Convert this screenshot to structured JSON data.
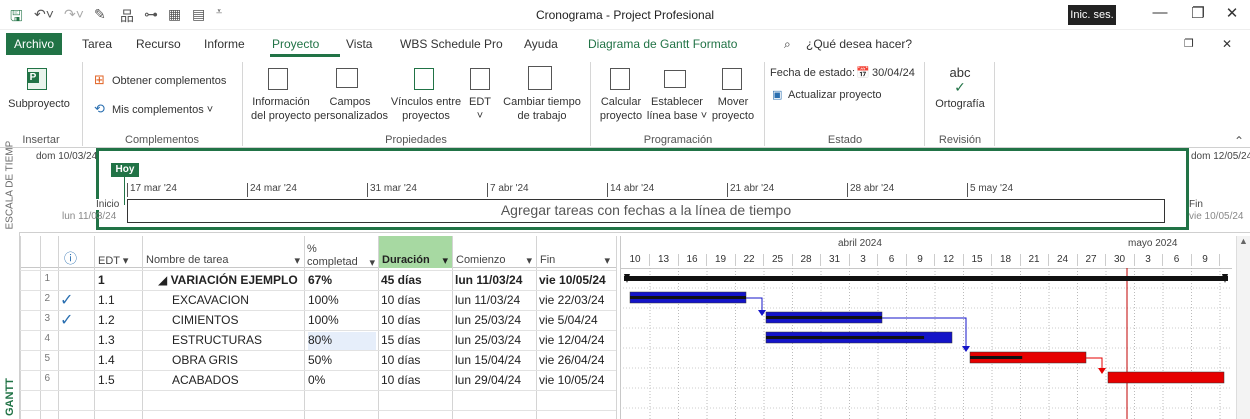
{
  "window": {
    "title": "Cronograma - Project Profesional",
    "signin": "Inic. ses.",
    "minimize": "—",
    "restore": "❐",
    "close": "✕",
    "ribbon_restore": "❐",
    "ribbon_close": "✕"
  },
  "menu": {
    "file": "Archivo",
    "tabs": [
      "Tarea",
      "Recurso",
      "Informe",
      "Proyecto",
      "Vista",
      "WBS Schedule Pro",
      "Ayuda"
    ],
    "context": "Diagrama de Gantt  Formato",
    "search": "¿Qué desea hacer?"
  },
  "ribbon": {
    "subproyecto": "Subproyecto",
    "obtener": "Obtener complementos",
    "mis": "Mis complementos",
    "info": [
      "Información",
      "del proyecto"
    ],
    "campos": [
      "Campos",
      "personalizados"
    ],
    "vinculos": [
      "Vínculos entre",
      "proyectos"
    ],
    "edt": "EDT",
    "cambiar": [
      "Cambiar tiempo",
      "de trabajo"
    ],
    "calcular": [
      "Calcular",
      "proyecto"
    ],
    "establecer": [
      "Establecer",
      "línea base"
    ],
    "mover": [
      "Mover",
      "proyecto"
    ],
    "fecha_estado_label": "Fecha de estado:",
    "fecha_estado_value": "30/04/24",
    "actualizar": "Actualizar proyecto",
    "abc": "abc",
    "ortografia": "Ortografía",
    "groups": [
      "Insertar",
      "Complementos",
      "Propiedades",
      "Programación",
      "Estado",
      "Revisión"
    ]
  },
  "timeline": {
    "side_label": "ESCALA DE TIEMPO",
    "left_date": "dom 10/03/24",
    "right_date": "dom 12/05/24",
    "today": "Hoy",
    "start_label": "Inicio",
    "start_date": "lun 11/03/24",
    "end_label": "Fin",
    "end_date": "vie 10/05/24",
    "placeholder": "Agregar tareas con fechas a la línea de tiempo",
    "ticks": [
      "17 mar '24",
      "24 mar '24",
      "31 mar '24",
      "7 abr '24",
      "14 abr '24",
      "21 abr '24",
      "28 abr '24",
      "5 may '24"
    ]
  },
  "table": {
    "side_label": "GANTT",
    "headers": {
      "info": "ⓘ",
      "edt": "EDT",
      "name": "Nombre de tarea",
      "pct1": "%",
      "pct2": "completad",
      "dur": "Duración",
      "start": "Comienzo",
      "end": "Fin"
    },
    "rows": [
      {
        "id": "1",
        "check": "",
        "edt": "1",
        "name": "◢ VARIACIÓN EJEMPLO",
        "pct": "67%",
        "dur": "45 días",
        "start": "lun 11/03/24",
        "end": "vie 10/05/24",
        "bold": true
      },
      {
        "id": "2",
        "check": "✓",
        "edt": "1.1",
        "name": "EXCAVACION",
        "pct": "100%",
        "dur": "10 días",
        "start": "lun 11/03/24",
        "end": "vie 22/03/24"
      },
      {
        "id": "3",
        "check": "✓",
        "edt": "1.2",
        "name": "CIMIENTOS",
        "pct": "100%",
        "dur": "10 días",
        "start": "lun 25/03/24",
        "end": "vie 5/04/24"
      },
      {
        "id": "4",
        "check": "",
        "edt": "1.3",
        "name": "ESTRUCTURAS",
        "pct": "80%",
        "dur": "15 días",
        "start": "lun 25/03/24",
        "end": "vie 12/04/24"
      },
      {
        "id": "5",
        "check": "",
        "edt": "1.4",
        "name": "OBRA GRIS",
        "pct": "50%",
        "dur": "10 días",
        "start": "lun 15/04/24",
        "end": "vie 26/04/24"
      },
      {
        "id": "6",
        "check": "",
        "edt": "1.5",
        "name": "ACABADOS",
        "pct": "0%",
        "dur": "10 días",
        "start": "lun 29/04/24",
        "end": "vie 10/05/24"
      }
    ]
  },
  "gantt": {
    "month1": "abril 2024",
    "month2": "mayo 2024",
    "days": [
      "10",
      "13",
      "16",
      "19",
      "22",
      "25",
      "28",
      "31",
      "3",
      "6",
      "9",
      "12",
      "15",
      "18",
      "21",
      "24",
      "27",
      "30",
      "3",
      "6",
      "9"
    ],
    "blue": "#1414c8",
    "red": "#e60000"
  }
}
